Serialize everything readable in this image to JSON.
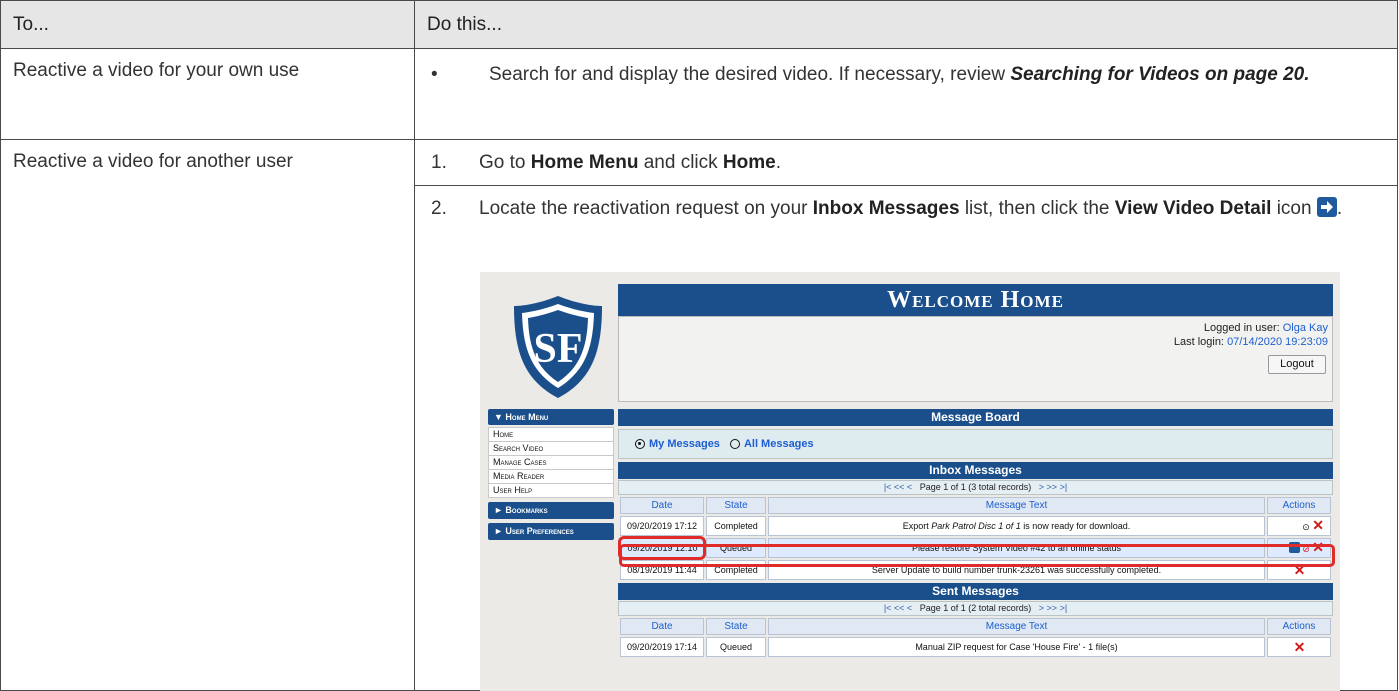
{
  "table": {
    "headers": [
      "To...",
      "Do this..."
    ],
    "rows": [
      {
        "action": "Reactive a video for your own use",
        "bullet": "•",
        "text_a": "Search for and display the desired video. If necessary, review ",
        "link_text": "Searching for Videos on page 20.",
        "text_b": ""
      },
      {
        "action": "Reactive a video for another user",
        "steps": [
          {
            "num": "1.",
            "t1": "Go to ",
            "b1": "Home Menu",
            "t2": " and click ",
            "b2": "Home",
            "t3": "."
          },
          {
            "num": "2.",
            "t1": "Locate the reactivation request on your ",
            "b1": "Inbox Messages",
            "t2": " list, then click the ",
            "b2": "View Video Detail",
            "t3": " icon "
          }
        ]
      }
    ]
  },
  "screenshot": {
    "banner": "Welcome Home",
    "logo_text": "SF",
    "user": {
      "logged_label": "Logged in user:",
      "name": "Olga Kay",
      "login_label": "Last login:",
      "last_login": "07/14/2020 19:23:09",
      "logout": "Logout"
    },
    "sidebar": {
      "menu_header": "▼ Home Menu",
      "items": [
        "Home",
        "Search Video",
        "Manage Cases",
        "Media Reader",
        "User Help"
      ],
      "bookmarks": "► Bookmarks",
      "preferences": "► User Preferences"
    },
    "message_board": "Message Board",
    "radio_my": "My Messages",
    "radio_all": "All Messages",
    "inbox": {
      "title": "Inbox Messages",
      "pager": "Page 1 of 1 (3 total records)",
      "cols": [
        "Date",
        "State",
        "Message Text",
        "Actions"
      ],
      "rows": [
        {
          "date": "09/20/2019 17:12",
          "state": "Completed",
          "pre": "Export ",
          "ital": "Park Patrol Disc 1 of 1",
          "post": " is now ready for download."
        },
        {
          "date": "09/20/2019 12:10",
          "state": "Queued",
          "pre": "Please restore System Video #42 to an online status",
          "ital": "",
          "post": ""
        },
        {
          "date": "08/19/2019 11:44",
          "state": "Completed",
          "pre": "Server Update to build number trunk-23261 was successfully completed.",
          "ital": "",
          "post": ""
        }
      ]
    },
    "sent": {
      "title": "Sent Messages",
      "pager": "Page 1 of 1 (2 total records)",
      "cols": [
        "Date",
        "State",
        "Message Text",
        "Actions"
      ],
      "rows": [
        {
          "date": "09/20/2019 17:14",
          "state": "Queued",
          "text": "Manual ZIP request for Case 'House Fire' - 1 file(s)"
        }
      ]
    },
    "pager_nav_left": "|< << <",
    "pager_nav_right": "> >> >|",
    "x_glyph": "✕"
  }
}
